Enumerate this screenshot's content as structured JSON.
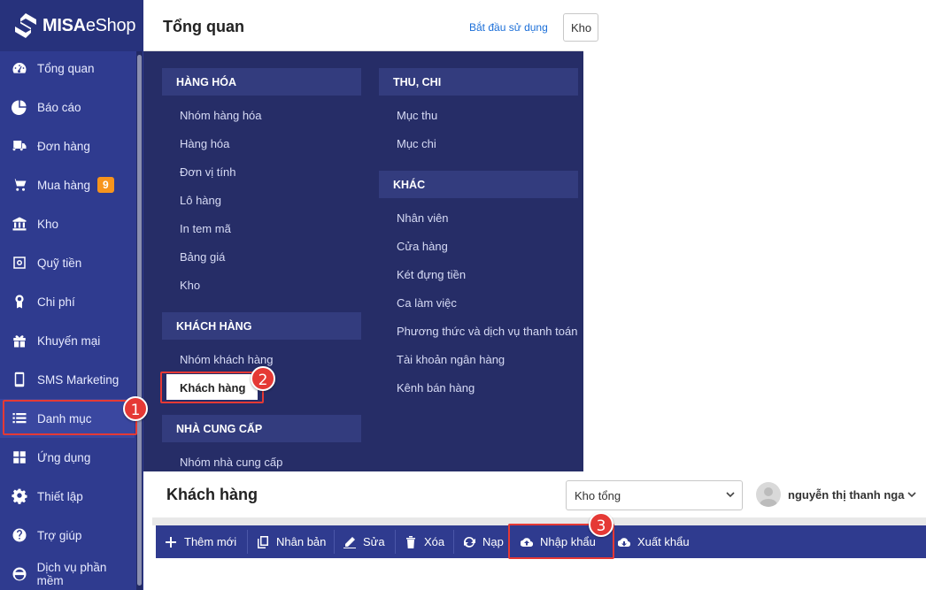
{
  "app": {
    "logo_main": "MISA",
    "logo_sub": "eShop"
  },
  "sidebar": {
    "items": [
      {
        "label": "Tổng quan",
        "icon": "dashboard-icon"
      },
      {
        "label": "Báo cáo",
        "icon": "pie-chart-icon"
      },
      {
        "label": "Đơn hàng",
        "icon": "truck-icon"
      },
      {
        "label": "Mua hàng",
        "icon": "cart-icon",
        "badge": "9"
      },
      {
        "label": "Kho",
        "icon": "warehouse-icon"
      },
      {
        "label": "Quỹ tiền",
        "icon": "safe-icon"
      },
      {
        "label": "Chi phí",
        "icon": "money-icon"
      },
      {
        "label": "Khuyến mại",
        "icon": "gift-icon"
      },
      {
        "label": "SMS Marketing",
        "icon": "phone-icon"
      },
      {
        "label": "Danh mục",
        "icon": "list-icon"
      },
      {
        "label": "Ứng dụng",
        "icon": "apps-icon"
      },
      {
        "label": "Thiết lập",
        "icon": "gear-icon"
      },
      {
        "label": "Trợ giúp",
        "icon": "help-icon"
      },
      {
        "label": "Dịch vụ phần mềm",
        "icon": "service-icon"
      }
    ]
  },
  "header": {
    "title": "Tổng quan",
    "getting_started": "Bắt đầu sử dụng",
    "store_select_partial": "Kho"
  },
  "menu": {
    "hang_hoa": {
      "title": "HÀNG HÓA",
      "items": [
        "Nhóm hàng hóa",
        "Hàng hóa",
        "Đơn vị tính",
        "Lô hàng",
        "In tem mã",
        "Bảng giá",
        "Kho"
      ]
    },
    "khach_hang": {
      "title": "KHÁCH HÀNG",
      "items": [
        "Nhóm khách hàng",
        "Khách hàng"
      ]
    },
    "nha_cung_cap": {
      "title": "NHÀ CUNG CẤP",
      "items": [
        "Nhóm nhà cung cấp"
      ]
    },
    "thu_chi": {
      "title": "THU, CHI",
      "items": [
        "Mục thu",
        "Mục chi"
      ]
    },
    "khac": {
      "title": "KHÁC",
      "items": [
        "Nhân viên",
        "Cửa hàng",
        "Két đựng tiền",
        "Ca làm việc",
        "Phương thức và dịch vụ thanh toán",
        "Tài khoản ngân hàng",
        "Kênh bán hàng"
      ]
    }
  },
  "customers_page": {
    "title": "Khách hàng",
    "store_select": "Kho tổng",
    "user_name": "nguyễn thị thanh nga",
    "toolbar": {
      "add": "Thêm mới",
      "duplicate": "Nhân bản",
      "edit": "Sửa",
      "delete": "Xóa",
      "reload": "Nạp",
      "import": "Nhập khẩu",
      "export": "Xuất khẩu"
    }
  },
  "annotations": {
    "step1": "1",
    "step2": "2",
    "step3": "3"
  },
  "colors": {
    "sidebar": "#2f3b8f",
    "menu_panel": "#262d67",
    "highlight": "#e53935",
    "badge": "#f7941d",
    "link": "#1a6ed8"
  }
}
